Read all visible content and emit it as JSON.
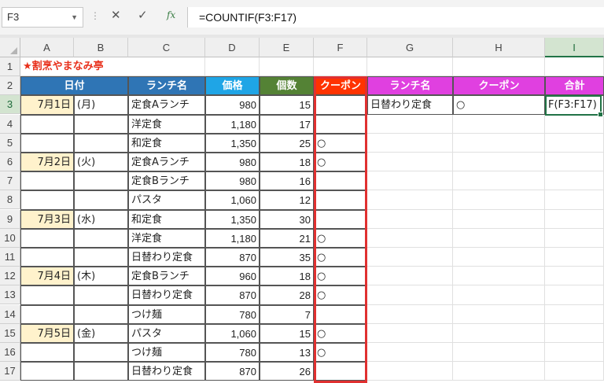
{
  "formula_bar": {
    "name_box": "F3",
    "formula": "=COUNTIF(F3:F17)",
    "cancel_icon": "✕",
    "enter_icon": "✓",
    "fx_label": "fx"
  },
  "columns": [
    "A",
    "B",
    "C",
    "D",
    "E",
    "F",
    "G",
    "H",
    "I"
  ],
  "selected_column": "I",
  "rows": [
    "1",
    "2",
    "3",
    "4",
    "5",
    "6",
    "7",
    "8",
    "9",
    "10",
    "11",
    "12",
    "13",
    "14",
    "15",
    "16",
    "17"
  ],
  "selected_row": "3",
  "sheet": {
    "title": "★割烹やまなみ亭",
    "headers": {
      "date": "日付",
      "lunch": "ランチ名",
      "price": "価格",
      "count": "個数",
      "coupon": "クーポン",
      "lunch2": "ランチ名",
      "coupon2": "クーポン",
      "total": "合計"
    },
    "header_colors": {
      "date": "#2f75b5",
      "lunch": "#2f75b5",
      "price": "#1fa5e6",
      "count": "#548235",
      "coupon": "#ff3300",
      "lunch2": "#e040e0",
      "coupon2": "#e040e0",
      "total": "#e040e0"
    },
    "data_rows": [
      {
        "date": "7月1日",
        "dow": "(月)",
        "lunch": "定食Aランチ",
        "price": "980",
        "count": "15",
        "coupon": ""
      },
      {
        "date": "",
        "dow": "",
        "lunch": "洋定食",
        "price": "1,180",
        "count": "17",
        "coupon": ""
      },
      {
        "date": "",
        "dow": "",
        "lunch": "和定食",
        "price": "1,350",
        "count": "25",
        "coupon": "○"
      },
      {
        "date": "7月2日",
        "dow": "(火)",
        "lunch": "定食Aランチ",
        "price": "980",
        "count": "18",
        "coupon": "○"
      },
      {
        "date": "",
        "dow": "",
        "lunch": "定食Bランチ",
        "price": "980",
        "count": "16",
        "coupon": ""
      },
      {
        "date": "",
        "dow": "",
        "lunch": "パスタ",
        "price": "1,060",
        "count": "12",
        "coupon": ""
      },
      {
        "date": "7月3日",
        "dow": "(水)",
        "lunch": "和定食",
        "price": "1,350",
        "count": "30",
        "coupon": ""
      },
      {
        "date": "",
        "dow": "",
        "lunch": "洋定食",
        "price": "1,180",
        "count": "21",
        "coupon": "○"
      },
      {
        "date": "",
        "dow": "",
        "lunch": "日替わり定食",
        "price": "870",
        "count": "35",
        "coupon": "○"
      },
      {
        "date": "7月4日",
        "dow": "(木)",
        "lunch": "定食Bランチ",
        "price": "960",
        "count": "18",
        "coupon": "○"
      },
      {
        "date": "",
        "dow": "",
        "lunch": "日替わり定食",
        "price": "870",
        "count": "28",
        "coupon": "○"
      },
      {
        "date": "",
        "dow": "",
        "lunch": "つけ麺",
        "price": "780",
        "count": "7",
        "coupon": ""
      },
      {
        "date": "7月5日",
        "dow": "(金)",
        "lunch": "パスタ",
        "price": "1,060",
        "count": "15",
        "coupon": "○"
      },
      {
        "date": "",
        "dow": "",
        "lunch": "つけ麺",
        "price": "780",
        "count": "13",
        "coupon": "○"
      },
      {
        "date": "",
        "dow": "",
        "lunch": "日替わり定食",
        "price": "870",
        "count": "26",
        "coupon": ""
      }
    ],
    "criteria": {
      "lunch": "日替わり定食",
      "coupon": "○",
      "total": "F(F3:F17)"
    }
  }
}
